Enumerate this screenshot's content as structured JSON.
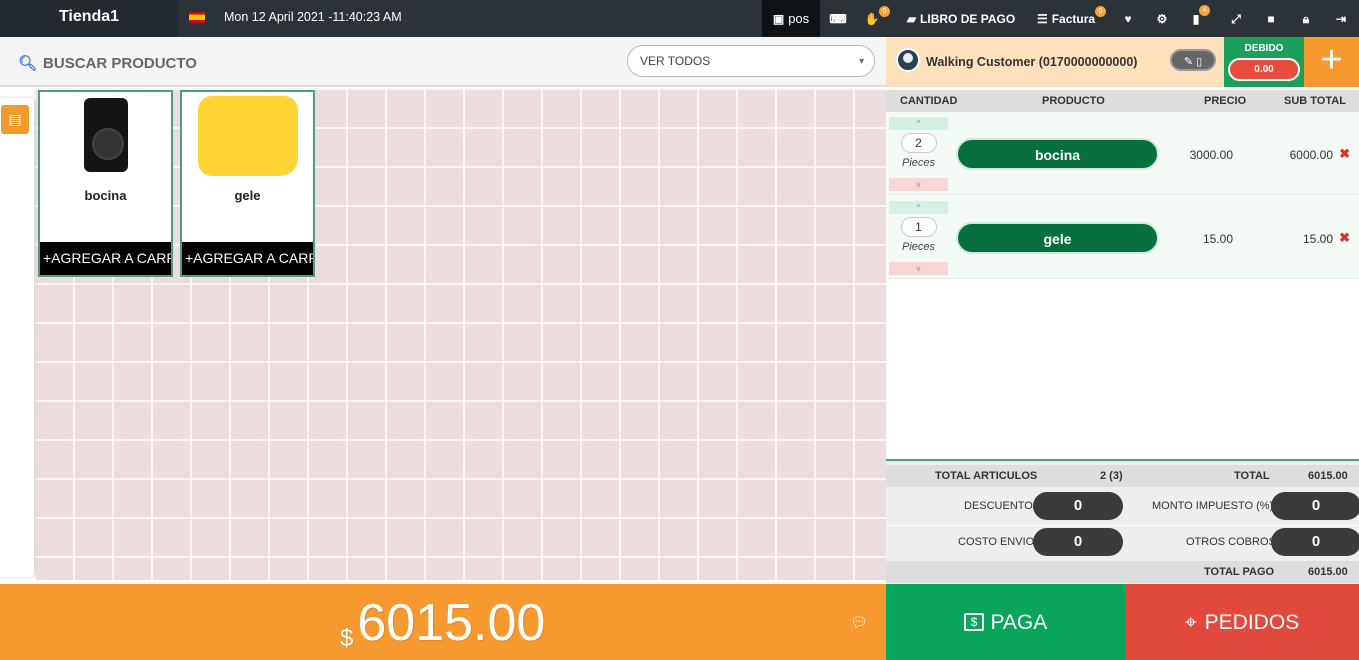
{
  "topbar": {
    "store": "Tienda1",
    "datetime": "Mon 12 April 2021 -11:40:23 AM",
    "pos_label": "pos",
    "hold_badge": "0",
    "libro_label": "LIBRO DE PAGO",
    "factura_label": "Factura",
    "factura_badge": "0",
    "notif_badge": "4"
  },
  "search": {
    "label": "BUSCAR PRODUCTO",
    "filter_value": "VER TODOS"
  },
  "products": [
    {
      "name": "bocina",
      "button": "+AGREGAR A CARRITO"
    },
    {
      "name": "gele",
      "button": "+AGREGAR A CARRITO"
    }
  ],
  "customer": {
    "name": "Walking Customer (0170000000000)",
    "debido_label": "DEBIDO",
    "debido_value": "0.00"
  },
  "cart": {
    "headers": {
      "qty": "CANTIDAD",
      "product": "PRODUCTO",
      "price": "PRECIO",
      "subtotal": "SUB TOTAL"
    },
    "items": [
      {
        "qty": "2",
        "unit": "Pieces",
        "product": "bocina",
        "price": "3000.00",
        "subtotal": "6000.00"
      },
      {
        "qty": "1",
        "unit": "Pieces",
        "product": "gele",
        "price": "15.00",
        "subtotal": "15.00"
      }
    ]
  },
  "totals": {
    "articulos_label": "TOTAL ARTICULOS",
    "articulos_value": "2 (3)",
    "total_label": "TOTAL",
    "total_value": "6015.00",
    "descuento_label": "DESCUENTO",
    "descuento_value": "0",
    "impuesto_label": "MONTO IMPUESTO (%)",
    "impuesto_value": "0",
    "envio_label": "COSTO ENVIO",
    "envio_value": "0",
    "otros_label": "OTROS COBROS",
    "otros_value": "0",
    "pago_label": "TOTAL PAGO",
    "pago_value": "6015.00"
  },
  "footer": {
    "currency": "$",
    "amount": "6015.00",
    "paga_label": "PAGA",
    "pedidos_label": "PEDIDOS"
  },
  "colors": {
    "topbar": "#2b3238",
    "accent_orange": "#f6992f",
    "green": "#0aa55d",
    "dark_green": "#08703f",
    "red": "#e2493d"
  }
}
